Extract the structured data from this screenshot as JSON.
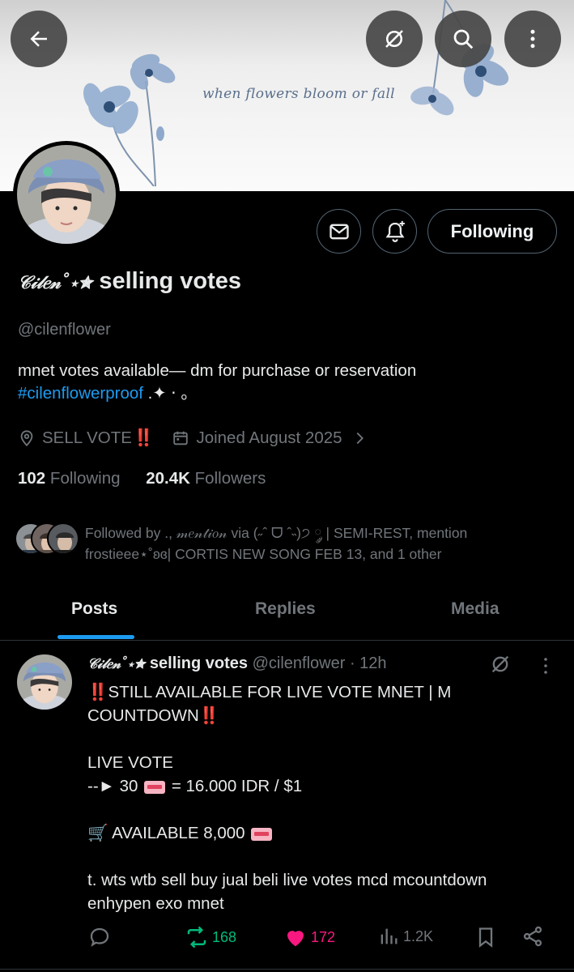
{
  "banner": {
    "text": "when flowers bloom or fall"
  },
  "profile": {
    "name_deco": "𝒞𝒾𝓁𝑒𝓃˚⋆✮",
    "name_main": "selling votes",
    "handle": "@cilenflower",
    "bio_text": "mnet votes available— dm for purchase or reservation",
    "bio_hashtag": "#cilenflowerproof",
    "bio_suffix": " .✦ ⋅ ｡",
    "location_text": "SELL VOTE",
    "location_emoji": "‼️",
    "joined": "Joined August 2025",
    "following_count": "102",
    "following_label": "Following",
    "followers_count": "20.4K",
    "followers_label": "Followers",
    "followed_by": "Followed by ., 𝓂𝑒𝓃𝓉𝒾𝑜𝓃 via (˶ˆ ᗜ ˆ˵)੭ ༘ | SEMI-REST, mention frostieee⋆˚ʚɞ| CORTIS NEW SONG FEB 13, and 1 other"
  },
  "buttons": {
    "following": "Following"
  },
  "tabs": [
    {
      "label": "Posts",
      "active": true
    },
    {
      "label": "Replies",
      "active": false
    },
    {
      "label": "Media",
      "active": false
    }
  ],
  "post": {
    "author_deco": "𝒞𝒾𝓁𝑒𝓃˚⋆✮",
    "author_main": "selling votes",
    "handle": "@cilenflower",
    "time": "· 12h",
    "line1_mark": "‼️",
    "line1_text": "STILL AVAILABLE FOR LIVE VOTE MNET | M COUNTDOWN",
    "line1_mark_end": "‼️",
    "line2": "LIVE VOTE",
    "line3_pre": "--► 30",
    "line3_post": "= 16.000 IDR / $1",
    "line4_pre": "🛒 AVAILABLE 8,000",
    "line5": "t. wts wtb sell buy jual beli live votes mcd mcountdown enhypen exo mnet",
    "reposts": "168",
    "likes": "172",
    "views": "1.2K"
  },
  "colors": {
    "accent": "#1d9bf0",
    "repost": "#00ba7c",
    "like": "#f91880",
    "muted": "#71767b"
  }
}
